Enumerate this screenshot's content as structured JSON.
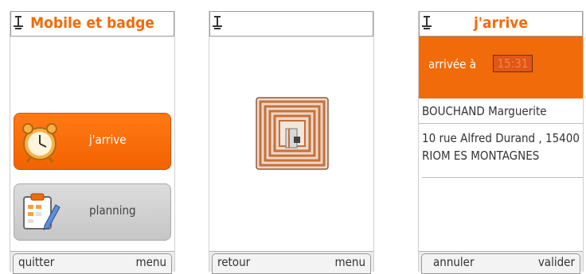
{
  "screen1": {
    "title": "Mobile et badge",
    "menu_items": [
      {
        "label": "j'arrive",
        "icon": "alarm-clock-icon"
      },
      {
        "label": "planning",
        "icon": "clipboard-pencil-icon"
      }
    ],
    "softkeys": {
      "left": "quitter",
      "right": "menu"
    }
  },
  "screen2": {
    "image": "rfid-tag-icon",
    "softkeys": {
      "left": "retour",
      "right": "menu"
    }
  },
  "screen3": {
    "title": "j'arrive",
    "arrival_label": "arrivée à",
    "arrival_time": "15:31",
    "name": "BOUCHAND Marguerite",
    "address_line1": "10 rue Alfred Durand , 15400",
    "address_line2": "RIOM ES MONTAGNES",
    "softkeys": {
      "left": "annuler",
      "right": "valider"
    }
  },
  "colors": {
    "accent": "#f26b0a",
    "grey": "#cccccc"
  }
}
